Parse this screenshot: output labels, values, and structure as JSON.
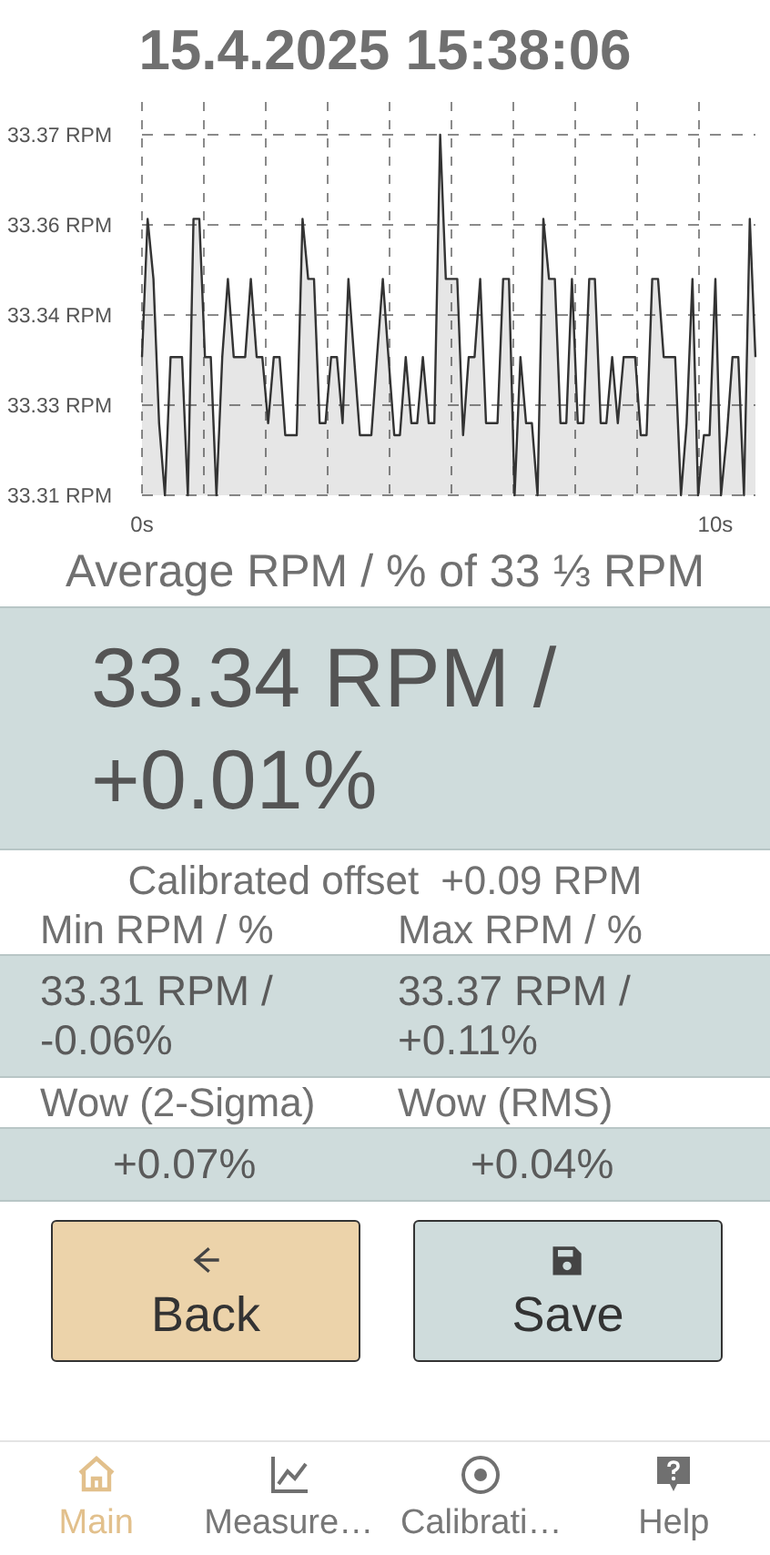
{
  "datetime": "15.4.2025 15:38:06",
  "chart": {
    "chart_data": {
      "type": "area",
      "grid": true,
      "xlim": [
        0,
        10.7
      ],
      "ylim": [
        33.31,
        33.37
      ],
      "xticks": [
        {
          "value": 0,
          "label": "0s"
        },
        {
          "value": 10,
          "label": "10s"
        }
      ],
      "yticks": [
        {
          "value": 33.31,
          "label": "33.31 RPM"
        },
        {
          "value": 33.325,
          "label": "33.33 RPM"
        },
        {
          "value": 33.34,
          "label": "33.34 RPM"
        },
        {
          "value": 33.355,
          "label": "33.36 RPM"
        },
        {
          "value": 33.37,
          "label": "33.37 RPM"
        }
      ],
      "x": [
        0,
        0.1,
        0.2,
        0.3,
        0.4,
        0.5,
        0.6,
        0.7,
        0.8,
        0.9,
        1,
        1.1,
        1.2,
        1.3,
        1.4,
        1.5,
        1.6,
        1.7,
        1.8,
        1.9,
        2,
        2.1,
        2.2,
        2.3,
        2.4,
        2.5,
        2.6,
        2.7,
        2.8,
        2.9,
        3,
        3.1,
        3.2,
        3.3,
        3.4,
        3.5,
        3.6,
        3.7,
        3.8,
        3.9,
        4,
        4.1,
        4.2,
        4.3,
        4.4,
        4.5,
        4.6,
        4.7,
        4.8,
        4.9,
        5,
        5.1,
        5.2,
        5.3,
        5.4,
        5.5,
        5.6,
        5.7,
        5.8,
        5.9,
        6,
        6.1,
        6.2,
        6.3,
        6.4,
        6.5,
        6.6,
        6.7,
        6.8,
        6.9,
        7,
        7.1,
        7.2,
        7.3,
        7.4,
        7.5,
        7.6,
        7.7,
        7.8,
        7.9,
        8,
        8.1,
        8.2,
        8.3,
        8.4,
        8.5,
        8.6,
        8.7,
        8.8,
        8.9,
        9,
        9.1,
        9.2,
        9.3,
        9.4,
        9.5,
        9.6,
        9.7,
        9.8,
        9.9,
        10,
        10.1,
        10.2,
        10.3,
        10.4,
        10.5,
        10.6,
        10.7
      ],
      "series": [
        {
          "color": "#333333",
          "values": [
            33.333,
            33.356,
            33.346,
            33.322,
            33.31,
            33.333,
            33.333,
            33.333,
            33.31,
            33.356,
            33.356,
            33.333,
            33.333,
            33.31,
            33.333,
            33.346,
            33.333,
            33.333,
            33.333,
            33.346,
            33.333,
            33.333,
            33.322,
            33.333,
            33.333,
            33.32,
            33.32,
            33.32,
            33.356,
            33.346,
            33.346,
            33.322,
            33.322,
            33.333,
            33.333,
            33.322,
            33.346,
            33.333,
            33.32,
            33.32,
            33.32,
            33.333,
            33.346,
            33.333,
            33.32,
            33.32,
            33.333,
            33.322,
            33.322,
            33.333,
            33.322,
            33.322,
            33.37,
            33.346,
            33.346,
            33.346,
            33.32,
            33.333,
            33.333,
            33.346,
            33.322,
            33.322,
            33.322,
            33.346,
            33.346,
            33.31,
            33.333,
            33.322,
            33.322,
            33.31,
            33.356,
            33.346,
            33.346,
            33.322,
            33.322,
            33.346,
            33.322,
            33.322,
            33.346,
            33.346,
            33.322,
            33.322,
            33.333,
            33.322,
            33.333,
            33.333,
            33.333,
            33.32,
            33.32,
            33.346,
            33.346,
            33.333,
            33.333,
            33.333,
            33.31,
            33.322,
            33.346,
            33.31,
            33.32,
            33.32,
            33.346,
            33.31,
            33.32,
            33.333,
            33.333,
            33.31,
            33.356,
            33.333
          ]
        }
      ]
    }
  },
  "average": {
    "label": "Average RPM / % of 33 ⅓ RPM",
    "value": "33.34 RPM / +0.01%"
  },
  "calibrated_offset": {
    "label": "Calibrated offset",
    "value": "+0.09 RPM"
  },
  "stats": [
    {
      "label": "Min RPM / %",
      "value": "33.31 RPM / -0.06%"
    },
    {
      "label": "Max RPM / %",
      "value": "33.37 RPM / +0.11%"
    },
    {
      "label": "Wow (2-Sigma)",
      "value": "+0.07%"
    },
    {
      "label": "Wow (RMS)",
      "value": "+0.04%"
    }
  ],
  "buttons": [
    {
      "label": "Back",
      "kind": "back"
    },
    {
      "label": "Save",
      "kind": "save"
    }
  ],
  "nav": [
    {
      "label": "Main",
      "selected": true
    },
    {
      "label": "Measure…",
      "selected": false
    },
    {
      "label": "Calibrati…",
      "selected": false
    },
    {
      "label": "Help",
      "selected": false
    }
  ]
}
